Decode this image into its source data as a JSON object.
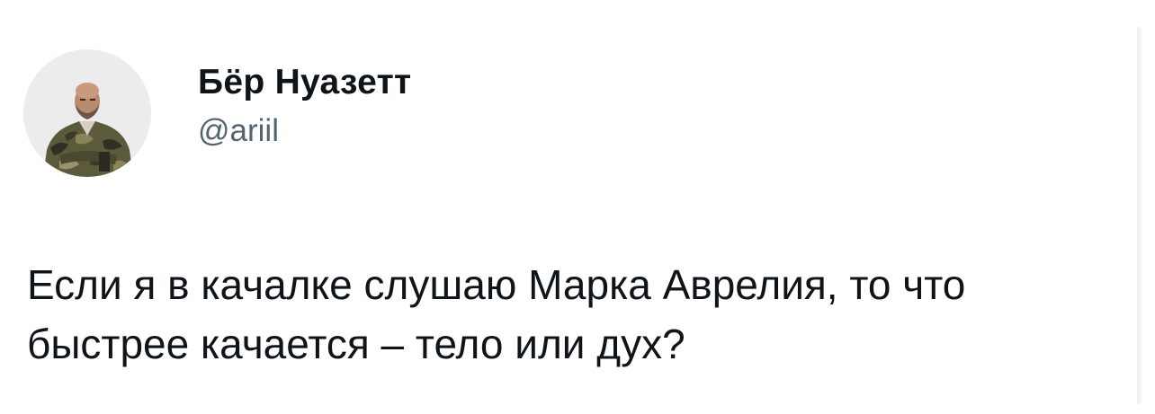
{
  "author": {
    "display_name": "Бёр Нуазетт",
    "handle": "@ariil"
  },
  "tweet": {
    "line1": "Если я в качалке слушаю Марка Аврелия, то что",
    "line2": "быстрее качается – тело или дух?"
  },
  "colors": {
    "name": "#0f1419",
    "handle": "#536471",
    "body_text": "#0f1419",
    "background": "#ffffff"
  }
}
